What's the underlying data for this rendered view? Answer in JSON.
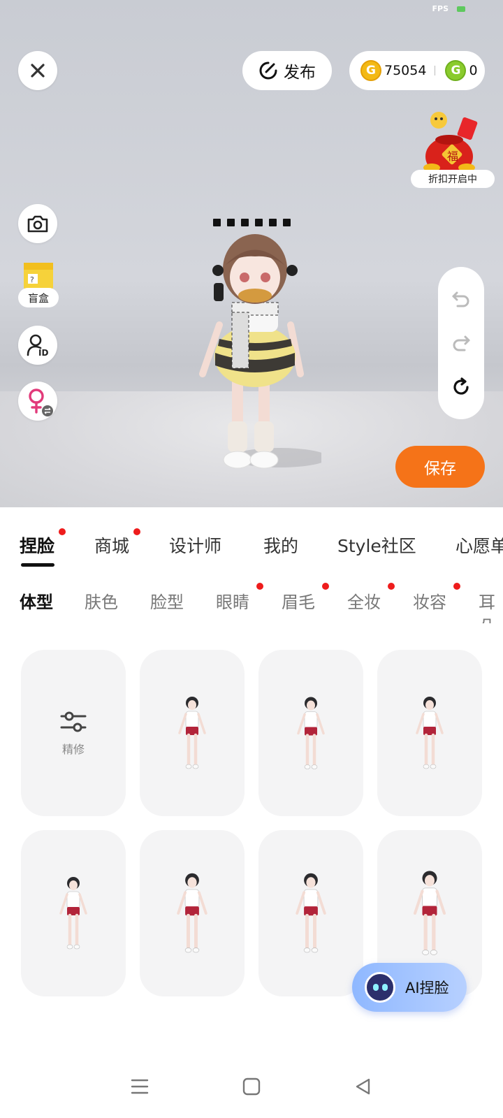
{
  "status": {
    "fps_label": "FPS"
  },
  "topbar": {
    "publish_label": "发布",
    "coins_gold": "75054",
    "coins_green": "0",
    "promo_label": "折扣开启中"
  },
  "left_tools": {
    "blindbox_label": "盲盒"
  },
  "actions": {
    "save_label": "保存"
  },
  "main_tabs": [
    {
      "label": "捏脸",
      "active": true,
      "dot": true
    },
    {
      "label": "商城",
      "active": false,
      "dot": true
    },
    {
      "label": "设计师",
      "active": false,
      "dot": false
    },
    {
      "label": "我的",
      "active": false,
      "dot": false
    },
    {
      "label": "Style社区",
      "active": false,
      "dot": false
    },
    {
      "label": "心愿单",
      "active": false,
      "dot": false
    }
  ],
  "sub_tabs": [
    {
      "label": "体型",
      "active": true,
      "dot": false
    },
    {
      "label": "肤色",
      "active": false,
      "dot": false
    },
    {
      "label": "脸型",
      "active": false,
      "dot": false
    },
    {
      "label": "眼睛",
      "active": false,
      "dot": true
    },
    {
      "label": "眉毛",
      "active": false,
      "dot": true
    },
    {
      "label": "全妆",
      "active": false,
      "dot": true
    },
    {
      "label": "妆容",
      "active": false,
      "dot": true
    },
    {
      "label": "耳朵",
      "active": false,
      "dot": false
    }
  ],
  "grid": {
    "refine_label": "精修"
  },
  "ai_button": {
    "label": "AI捏脸"
  },
  "colors": {
    "accent": "#f57318",
    "red_dot": "#ee1c1c",
    "coin_gold": "#f3b915",
    "coin_green": "#8acb2d"
  },
  "icons": [
    "close-icon",
    "publish-icon",
    "camera-icon",
    "blindbox-icon",
    "id-icon",
    "gender-swap-icon",
    "undo-icon",
    "redo-icon",
    "reset-icon",
    "sliders-icon",
    "menu-icon",
    "home-icon",
    "back-icon"
  ]
}
